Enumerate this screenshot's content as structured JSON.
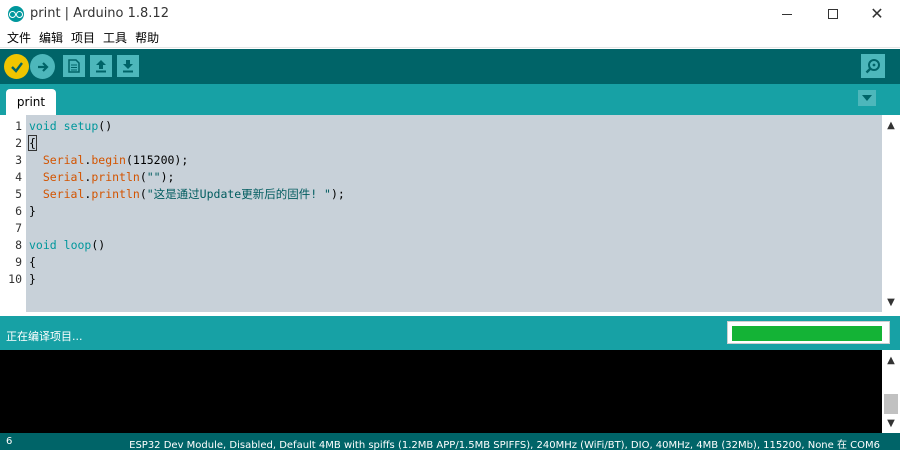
{
  "window": {
    "title": "print | Arduino 1.8.12",
    "minimize_glyph": "—",
    "maximize_glyph": "☐",
    "close_glyph": "✕"
  },
  "menu": [
    "文件",
    "编辑",
    "项目",
    "工具",
    "帮助"
  ],
  "toolbar": {
    "icons": [
      "check-icon",
      "arrow-right-icon",
      "new-file-icon",
      "upload-arrow-icon",
      "download-arrow-icon",
      "serial-monitor-icon"
    ]
  },
  "tabs": [
    {
      "label": "print"
    }
  ],
  "editor": {
    "line_numbers": [
      "1",
      "2",
      "3",
      "4",
      "5",
      "6",
      "7",
      "8",
      "9",
      "10"
    ],
    "lines": [
      [
        {
          "t": "void",
          "c": "kw"
        },
        {
          "t": " ",
          "c": "txt"
        },
        {
          "t": "setup",
          "c": "kw"
        },
        {
          "t": "()",
          "c": "txt"
        }
      ],
      [
        {
          "t": "{",
          "c": "txt"
        }
      ],
      [
        {
          "t": "  ",
          "c": "txt"
        },
        {
          "t": "Serial",
          "c": "fn"
        },
        {
          "t": ".",
          "c": "txt"
        },
        {
          "t": "begin",
          "c": "fn"
        },
        {
          "t": "(115200);",
          "c": "txt"
        }
      ],
      [
        {
          "t": "  ",
          "c": "txt"
        },
        {
          "t": "Serial",
          "c": "fn"
        },
        {
          "t": ".",
          "c": "txt"
        },
        {
          "t": "println",
          "c": "fn"
        },
        {
          "t": "(",
          "c": "txt"
        },
        {
          "t": "\"\"",
          "c": "str"
        },
        {
          "t": ");",
          "c": "txt"
        }
      ],
      [
        {
          "t": "  ",
          "c": "txt"
        },
        {
          "t": "Serial",
          "c": "fn"
        },
        {
          "t": ".",
          "c": "txt"
        },
        {
          "t": "println",
          "c": "fn"
        },
        {
          "t": "(",
          "c": "txt"
        },
        {
          "t": "\"这是通过Update更新后的固件! \"",
          "c": "str"
        },
        {
          "t": ");",
          "c": "txt"
        }
      ],
      [
        {
          "t": "}",
          "c": "txt"
        }
      ],
      [],
      [
        {
          "t": "void",
          "c": "kw"
        },
        {
          "t": " ",
          "c": "txt"
        },
        {
          "t": "loop",
          "c": "kw"
        },
        {
          "t": "()",
          "c": "txt"
        }
      ],
      [
        {
          "t": "{",
          "c": "txt"
        }
      ],
      [
        {
          "t": "}",
          "c": "txt"
        }
      ]
    ]
  },
  "status": {
    "message": "正在编译项目...",
    "progress": 0.98
  },
  "footer": {
    "line_number": "6",
    "board_info": "ESP32 Dev Module, Disabled, Default 4MB with spiffs (1.2MB APP/1.5MB SPIFFS), 240MHz (WiFi/BT), DIO, 40MHz, 4MB (32Mb), 115200, None 在 COM6"
  },
  "colors": {
    "toolbar": "#006468",
    "tabbar": "#17a1a5",
    "editor_bg": "#c8d1d9",
    "keyword": "#00979c",
    "function": "#d35400",
    "progress_fill": "#14b336",
    "verify_button": "#f0c500"
  }
}
